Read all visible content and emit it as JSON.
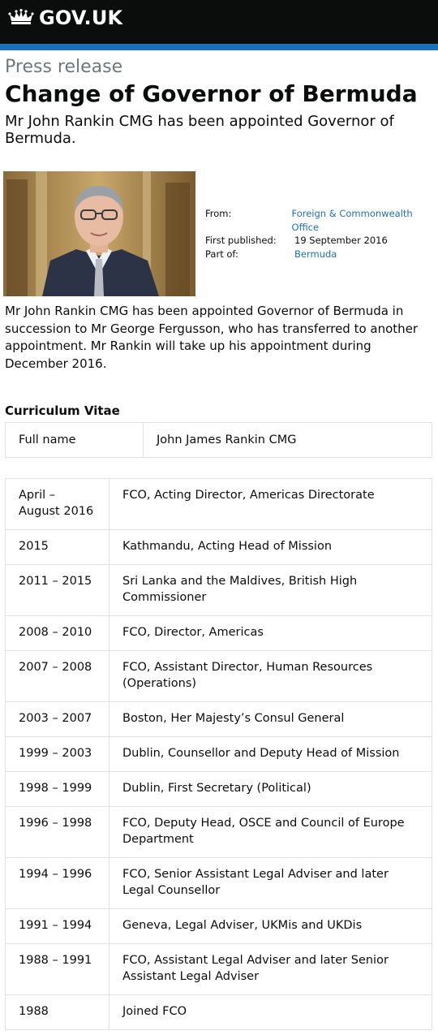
{
  "header": {
    "brand": "GOV.UK",
    "crown_icon": "crown-icon",
    "background": "#0b0c0c",
    "stripe_color": "#1d70b8"
  },
  "page": {
    "kicker": "Press release",
    "title": "Change of Governor of Bermuda",
    "summary": "Mr John Rankin CMG has been appointed Governor of Bermuda."
  },
  "metadata": {
    "from_label": "From:",
    "from_value": "Foreign & Commonwealth Office",
    "published_label": "First published:",
    "published_value": "19 September 2016",
    "part_of_label": "Part of:",
    "part_of_value": "Bermuda",
    "link_color": "#1d70b8"
  },
  "body": {
    "paragraph": "Mr John Rankin CMG has been appointed Governor of Bermuda in succession to Mr George Fergusson, who has transferred to another appointment. Mr Rankin will take up his appointment during December 2016."
  },
  "cv": {
    "heading": "Curriculum Vitae",
    "name_label": "Full name",
    "name_value": "John James Rankin CMG",
    "rows": [
      {
        "date": "April – August 2016",
        "role": "FCO, Acting Director, Americas Directorate"
      },
      {
        "date": "2015",
        "role": "Kathmandu, Acting Head of Mission"
      },
      {
        "date": "2011 – 2015",
        "role": "Sri Lanka and the Maldives, British High Commissioner"
      },
      {
        "date": "2008 – 2010",
        "role": "FCO, Director, Americas"
      },
      {
        "date": "2007 – 2008",
        "role": "FCO, Assistant Director, Human Resources (Operations)"
      },
      {
        "date": "2003 – 2007",
        "role": "Boston, Her Majesty’s Consul General"
      },
      {
        "date": "1999 – 2003",
        "role": "Dublin, Counsellor and Deputy Head of Mission"
      },
      {
        "date": "1998 – 1999",
        "role": "Dublin, First Secretary (Political)"
      },
      {
        "date": "1996 – 1998",
        "role": "FCO, Deputy Head, OSCE and Council of Europe Department"
      },
      {
        "date": "1994 – 1996",
        "role": "FCO, Senior Assistant Legal Adviser and later Legal Counsellor"
      },
      {
        "date": "1991 – 1994",
        "role": "Geneva, Legal Adviser, UKMis and UKDis"
      },
      {
        "date": "1988 – 1991",
        "role": "FCO, Assistant Legal Adviser and later Senior Assistant Legal Adviser"
      },
      {
        "date": "1988",
        "role": "Joined FCO"
      }
    ]
  }
}
